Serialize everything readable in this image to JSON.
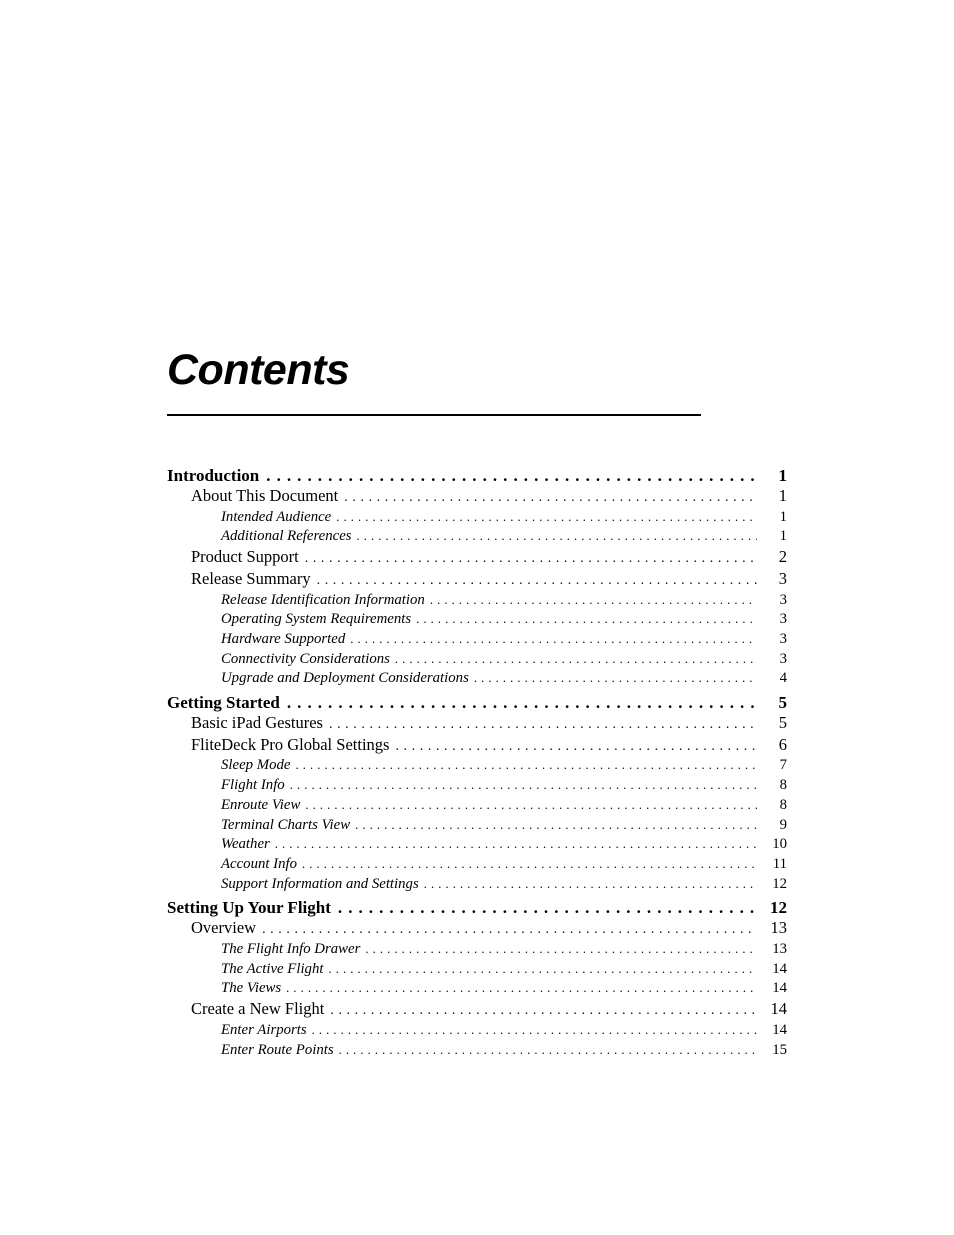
{
  "page": {
    "title": "Contents"
  },
  "toc": {
    "entries": [
      {
        "label": "Introduction",
        "page": "1",
        "level": 1
      },
      {
        "label": "About This Document",
        "page": "1",
        "level": 2
      },
      {
        "label": "Intended Audience",
        "page": "1",
        "level": 3
      },
      {
        "label": "Additional References",
        "page": "1",
        "level": 3
      },
      {
        "label": "Product Support",
        "page": "2",
        "level": 2
      },
      {
        "label": "Release Summary",
        "page": "3",
        "level": 2
      },
      {
        "label": "Release Identification Information",
        "page": "3",
        "level": 3
      },
      {
        "label": "Operating System Requirements",
        "page": "3",
        "level": 3
      },
      {
        "label": "Hardware Supported",
        "page": "3",
        "level": 3
      },
      {
        "label": "Connectivity Considerations",
        "page": "3",
        "level": 3
      },
      {
        "label": "Upgrade and Deployment Considerations",
        "page": "4",
        "level": 3
      },
      {
        "label": "Getting Started",
        "page": "5",
        "level": 1
      },
      {
        "label": "Basic iPad Gestures",
        "page": "5",
        "level": 2
      },
      {
        "label": "FliteDeck Pro Global Settings",
        "page": "6",
        "level": 2
      },
      {
        "label": "Sleep Mode",
        "page": "7",
        "level": 3
      },
      {
        "label": "Flight Info",
        "page": "8",
        "level": 3
      },
      {
        "label": "Enroute View",
        "page": "8",
        "level": 3
      },
      {
        "label": "Terminal Charts View",
        "page": "9",
        "level": 3
      },
      {
        "label": "Weather",
        "page": "10",
        "level": 3
      },
      {
        "label": "Account Info",
        "page": "11",
        "level": 3
      },
      {
        "label": "Support Information and Settings",
        "page": "12",
        "level": 3
      },
      {
        "label": "Setting Up Your Flight",
        "page": "12",
        "level": 1
      },
      {
        "label": "Overview",
        "page": "13",
        "level": 2
      },
      {
        "label": "The Flight Info Drawer",
        "page": "13",
        "level": 3
      },
      {
        "label": "The Active Flight",
        "page": "14",
        "level": 3
      },
      {
        "label": "The Views",
        "page": "14",
        "level": 3
      },
      {
        "label": "Create a New Flight",
        "page": "14",
        "level": 2
      },
      {
        "label": "Enter Airports",
        "page": "14",
        "level": 3
      },
      {
        "label": "Enter Route Points",
        "page": "15",
        "level": 3
      }
    ]
  }
}
